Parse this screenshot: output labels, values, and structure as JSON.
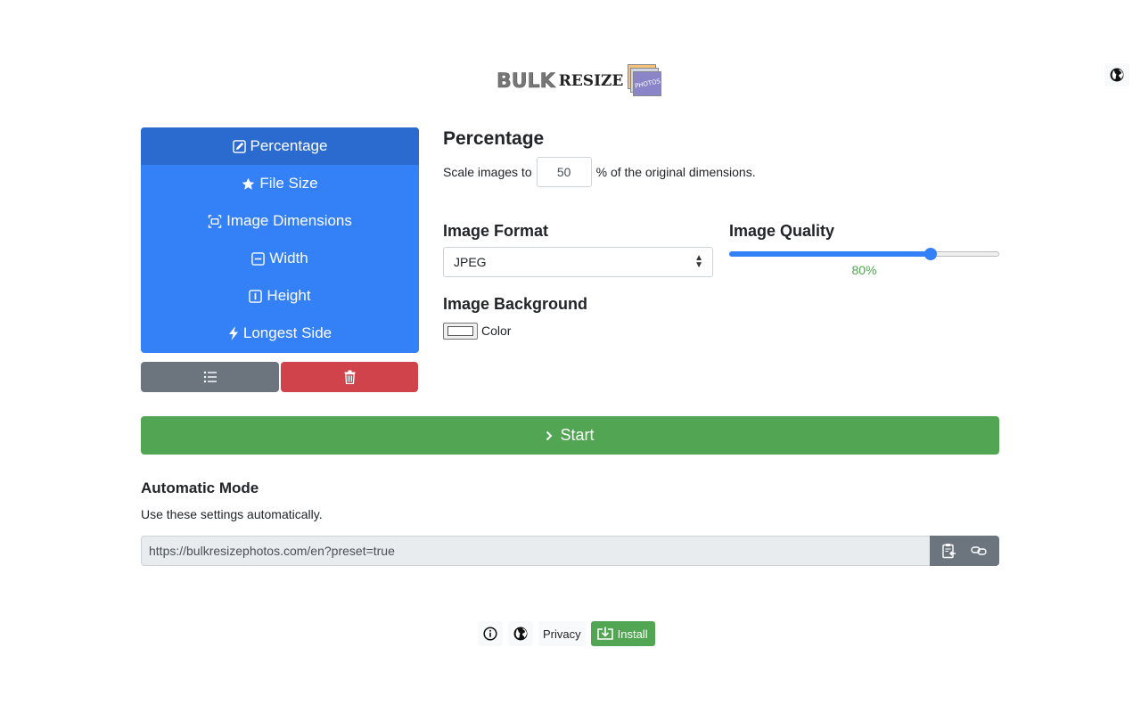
{
  "logo": {
    "part1": "BULK",
    "part2": "RESIZE",
    "part3": "PHOTOS"
  },
  "modes": [
    {
      "label": "Percentage",
      "icon": "pencil-square-icon",
      "active": true
    },
    {
      "label": "File Size",
      "icon": "star-icon",
      "active": false
    },
    {
      "label": "Image Dimensions",
      "icon": "dimensions-icon",
      "active": false
    },
    {
      "label": "Width",
      "icon": "width-icon",
      "active": false
    },
    {
      "label": "Height",
      "icon": "height-icon",
      "active": false
    },
    {
      "label": "Longest Side",
      "icon": "lightning-icon",
      "active": false
    }
  ],
  "percentage": {
    "heading": "Percentage",
    "prefix": "Scale images to",
    "value": "50",
    "suffix": "% of the original dimensions."
  },
  "format": {
    "heading": "Image Format",
    "selected": "JPEG"
  },
  "quality": {
    "heading": "Image Quality",
    "value": 80,
    "label": "80%"
  },
  "background": {
    "heading": "Image Background",
    "color_label": "Color",
    "color": "#ffffff"
  },
  "start": {
    "label": "Start"
  },
  "automatic": {
    "heading": "Automatic Mode",
    "description": "Use these settings automatically.",
    "url": "https://bulkresizephotos.com/en?preset=true"
  },
  "footer": {
    "privacy": "Privacy",
    "install": "Install"
  },
  "colors": {
    "primary": "#3480f7",
    "primary_active": "#2b6bd0",
    "success": "#52a552",
    "danger": "#d1434b",
    "secondary": "#6c757d"
  }
}
